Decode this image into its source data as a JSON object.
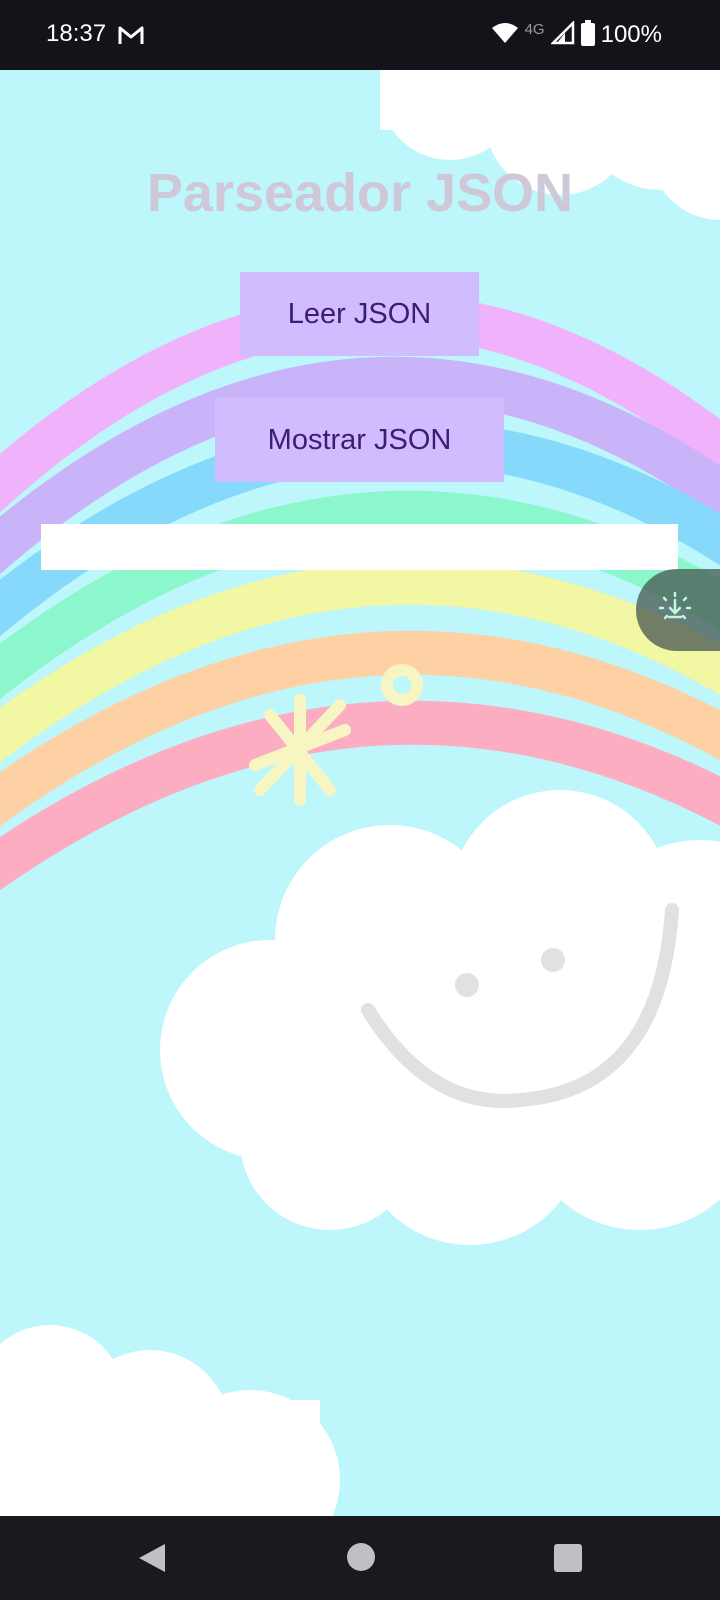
{
  "status_bar": {
    "time": "18:37",
    "network_type": "4G",
    "battery": "100%",
    "icons": [
      "gmail-icon",
      "wifi-icon",
      "signal-icon",
      "battery-icon"
    ]
  },
  "app": {
    "title": "Parseador JSON",
    "read_button_label": "Leer JSON",
    "show_button_label": "Mostrar JSON",
    "output_text": ""
  },
  "floating_button": {
    "icon": "download-sparkle-icon"
  },
  "navigation": {
    "icons": [
      "back-icon",
      "home-icon",
      "recents-icon"
    ]
  },
  "colors": {
    "button_bg": "#d0bcfe",
    "button_text": "#3b1d74",
    "title": "#cfc8d8",
    "background": "#bdf6fb"
  }
}
